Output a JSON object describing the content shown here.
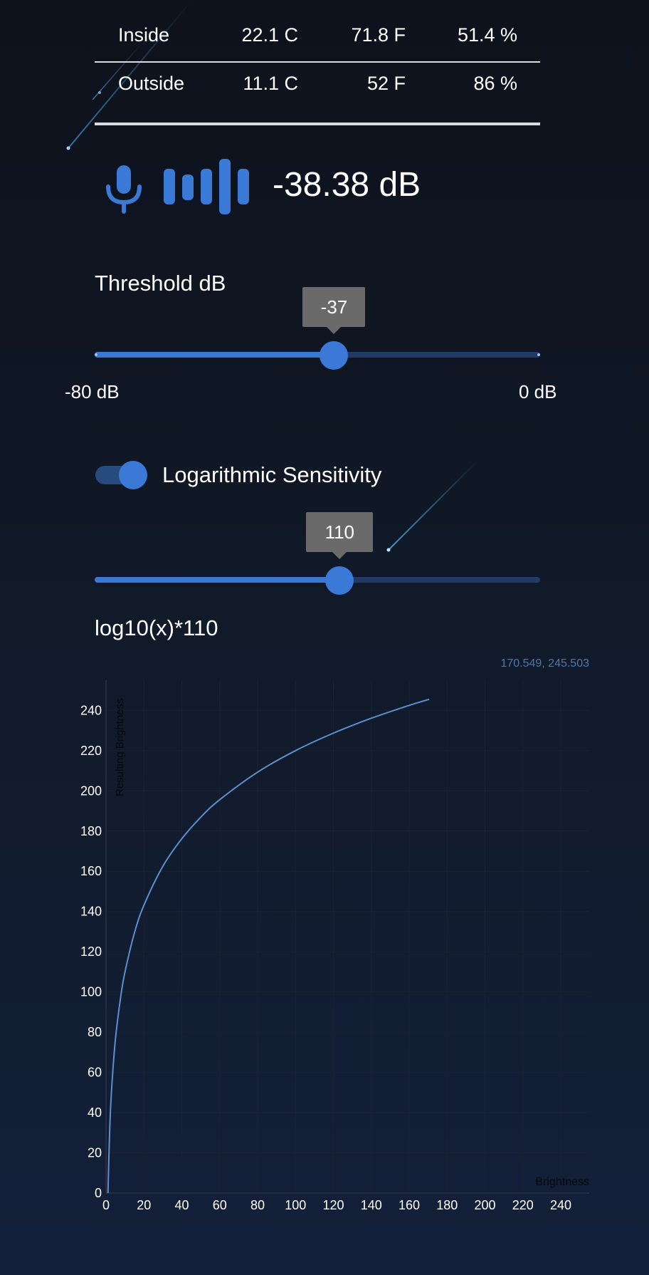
{
  "climate": {
    "rows": [
      {
        "location": "Inside",
        "celsius": "22.1 C",
        "fahrenheit": "71.8 F",
        "humidity": "51.4 %"
      },
      {
        "location": "Outside",
        "celsius": "11.1 C",
        "fahrenheit": "52 F",
        "humidity": "86 %"
      }
    ]
  },
  "sound": {
    "mic_icon": "microphone-icon",
    "level_icon": "audio-level-bars-icon",
    "level_db": "-38.38 dB"
  },
  "threshold": {
    "label": "Threshold dB",
    "value": -37,
    "value_text": "-37",
    "min": -80,
    "max": 0,
    "min_label": "-80 dB",
    "max_label": "0 dB"
  },
  "sensitivity": {
    "toggle_label": "Logarithmic Sensitivity",
    "toggle_on": true,
    "value": 110,
    "value_text": "110",
    "min": 0,
    "max": 200,
    "formula": "log10(x)*110"
  },
  "colors": {
    "accent": "#3b79d6",
    "track_inactive": "#213a66",
    "tooltip_bg": "#6a6a6a",
    "curve": "#5b8fd0",
    "hover_readout": "#4a78b0"
  },
  "chart_data": {
    "type": "line",
    "title": "",
    "xlabel": "Brightness",
    "ylabel": "Resulting Brightness",
    "hover_readout": "170.549, 245.503",
    "xlim": [
      0,
      255
    ],
    "ylim": [
      0,
      255
    ],
    "x_ticks": [
      0,
      20,
      40,
      60,
      80,
      100,
      120,
      140,
      160,
      180,
      200,
      220,
      240
    ],
    "y_ticks": [
      0,
      20,
      40,
      60,
      80,
      100,
      120,
      140,
      160,
      180,
      200,
      220,
      240
    ],
    "grid": true,
    "series": [
      {
        "x": [
          1,
          2,
          3,
          5,
          8,
          10,
          15,
          20,
          30,
          40,
          50,
          60,
          80,
          100,
          120,
          140,
          160,
          170.549
        ],
        "y": [
          0,
          33.1,
          52.5,
          76.9,
          99.3,
          110,
          129.4,
          143.1,
          162.5,
          176.2,
          186.9,
          195.6,
          209.3,
          220,
          228.7,
          236.1,
          242.5,
          245.5
        ]
      }
    ]
  }
}
